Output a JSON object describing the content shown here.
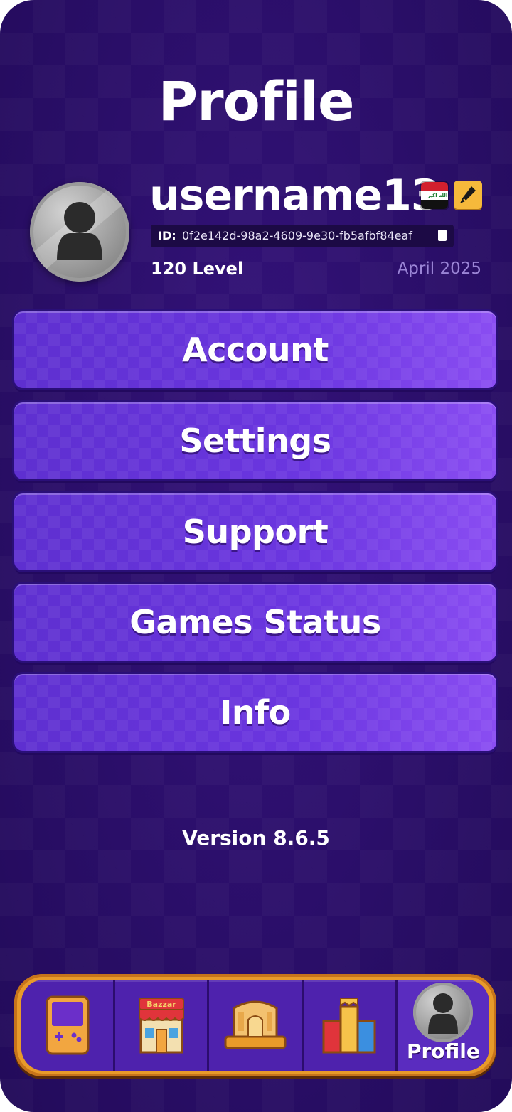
{
  "header": {
    "title": "Profile"
  },
  "profile": {
    "username": "username13",
    "id_label": "ID:",
    "id_value": "0f2e142d-98a2-4609-9e30-fb5afbf84eaf",
    "level": "120 Level",
    "joined": "April 2025",
    "flag": {
      "country": "Iraq",
      "text": "الله اكبر"
    }
  },
  "menu": [
    {
      "label": "Account"
    },
    {
      "label": "Settings"
    },
    {
      "label": "Support"
    },
    {
      "label": "Games Status"
    },
    {
      "label": "Info"
    }
  ],
  "footer": {
    "version": "Version 8.6.5"
  },
  "nav": {
    "tabs": [
      {
        "icon": "gameboy-icon"
      },
      {
        "icon": "bazzar-shop-icon",
        "sign": "Bazzar"
      },
      {
        "icon": "palace-icon"
      },
      {
        "icon": "leaderboard-podium-icon"
      },
      {
        "icon": "profile-avatar-icon",
        "label": "Profile",
        "active": true
      }
    ]
  },
  "colors": {
    "background": "#2a0e6a",
    "button": "#6b36e0",
    "nav_frame": "#e89a2a",
    "date": "#9b85d6"
  }
}
